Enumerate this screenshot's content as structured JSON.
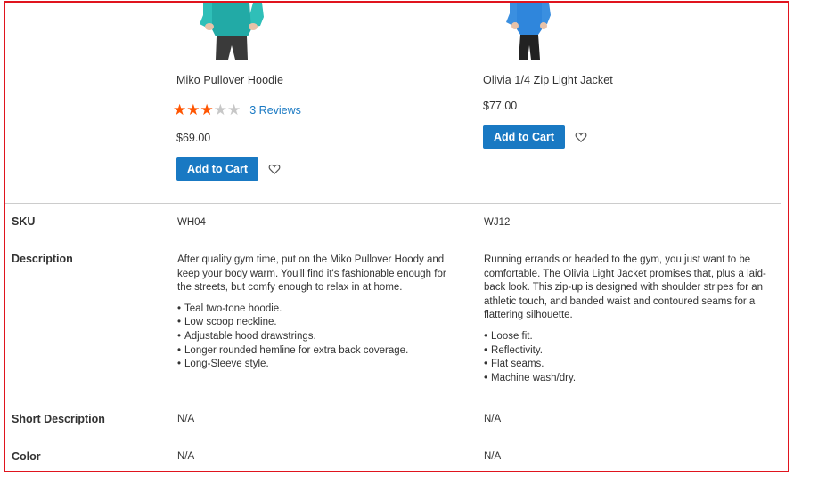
{
  "colors": {
    "accent": "#1979c3",
    "star_on": "#ff5501",
    "star_off": "#c7c7c7",
    "frame": "#e0141e"
  },
  "products": [
    {
      "name": "Miko Pullover Hoodie",
      "rating_stars": 3,
      "rating_max": 5,
      "reviews": "3 Reviews",
      "price": "$69.00",
      "add_to_cart": "Add to Cart",
      "wishlist_icon": "heart-icon",
      "sku": "WH04",
      "description": "After quality gym time, put on the Miko Pullover Hoody and keep your body warm. You'll find it's fashionable enough for the streets, but comfy enough to relax in at home.",
      "features": [
        "Teal two-tone hoodie.",
        "Low scoop neckline.",
        "Adjustable hood drawstrings.",
        "Longer rounded hemline for extra back coverage.",
        "Long-Sleeve style."
      ],
      "short_description": "N/A",
      "color": "N/A"
    },
    {
      "name": "Olivia 1/4 Zip Light Jacket",
      "price": "$77.00",
      "add_to_cart": "Add to Cart",
      "wishlist_icon": "heart-icon",
      "sku": "WJ12",
      "description": "Running errands or headed to the gym, you just want to be comfortable. The Olivia Light Jacket promises that, plus a laid-back look. This zip-up is designed with shoulder stripes for an athletic touch, and banded waist and contoured seams for a flattering silhouette.",
      "features": [
        "Loose fit.",
        "Reflectivity.",
        "Flat seams.",
        "Machine wash/dry."
      ],
      "short_description": "N/A",
      "color": "N/A"
    }
  ],
  "attributes": {
    "sku": "SKU",
    "description": "Description",
    "short_description": "Short Description",
    "color": "Color"
  }
}
